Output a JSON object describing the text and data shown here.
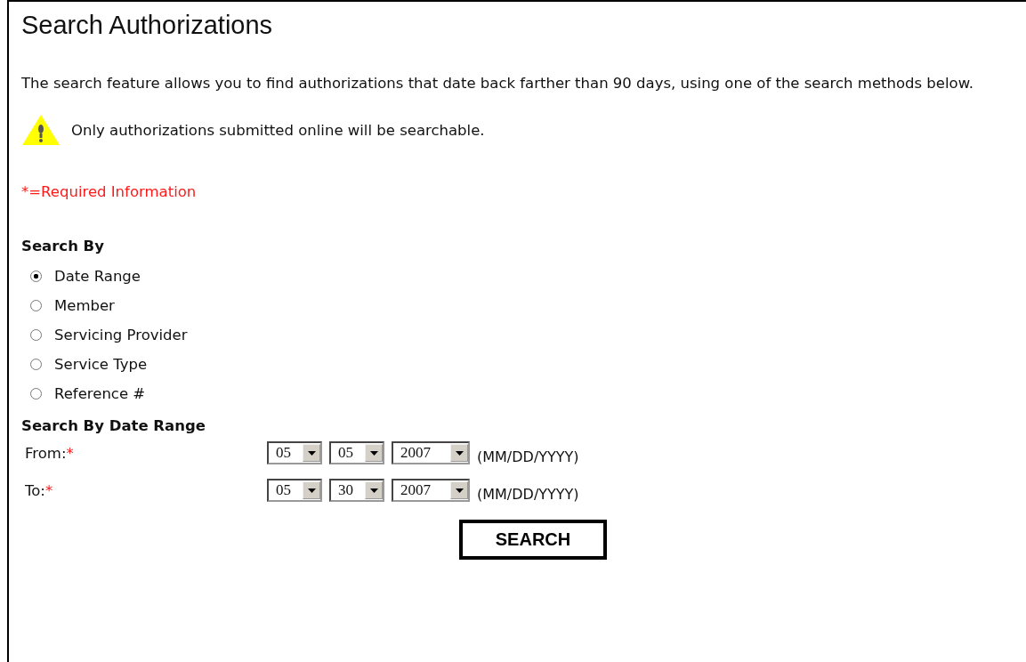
{
  "title": "Search Authorizations",
  "intro": "The search feature allows you to find authorizations that date back farther than 90 days, using one of the search methods below.",
  "warning": "Only authorizations submitted online will be searchable.",
  "required_note": "*=Required Information",
  "search_by": {
    "heading": "Search By",
    "options": [
      {
        "label": "Date Range",
        "selected": true
      },
      {
        "label": "Member",
        "selected": false
      },
      {
        "label": "Servicing Provider",
        "selected": false
      },
      {
        "label": "Service Type",
        "selected": false
      },
      {
        "label": "Reference #",
        "selected": false
      }
    ]
  },
  "date_range": {
    "heading": "Search By Date Range",
    "rows": [
      {
        "label": "From:",
        "required_mark": "*",
        "month": "05",
        "day": "05",
        "year": "2007",
        "format": "(MM/DD/YYYY)"
      },
      {
        "label": "To:",
        "required_mark": "*",
        "month": "05",
        "day": "30",
        "year": "2007",
        "format": "(MM/DD/YYYY)"
      }
    ]
  },
  "button": "SEARCH"
}
